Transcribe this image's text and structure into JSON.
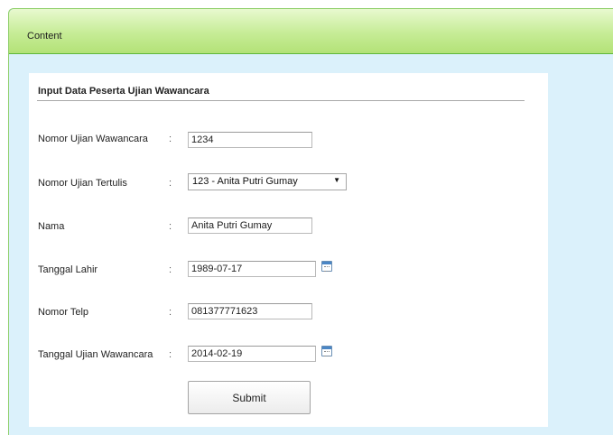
{
  "panel": {
    "title": "Content"
  },
  "form": {
    "title": "Input Data Peserta Ujian Wawancara",
    "colon": ":",
    "fields": {
      "nomor_ujian_wawancara": {
        "label": "Nomor Ujian Wawancara",
        "value": "1234"
      },
      "nomor_ujian_tertulis": {
        "label": "Nomor Ujian Tertulis",
        "selected": "123 - Anita Putri Gumay"
      },
      "nama": {
        "label": "Nama",
        "value": "Anita Putri Gumay"
      },
      "tanggal_lahir": {
        "label": "Tanggal Lahir",
        "value": "1989-07-17"
      },
      "nomor_telp": {
        "label": "Nomor Telp",
        "value": "081377771623"
      },
      "tanggal_ujian_wawancara": {
        "label": "Tanggal Ujian Wawancara",
        "value": "2014-02-19"
      }
    },
    "submit_label": "Submit"
  },
  "icons": {
    "calendar": "calendar-icon",
    "dropdown": "chevron-down-icon"
  },
  "colors": {
    "header_green": "#b3e277",
    "panel_blue": "#dbf1fb",
    "border_green": "#5eb83a"
  }
}
